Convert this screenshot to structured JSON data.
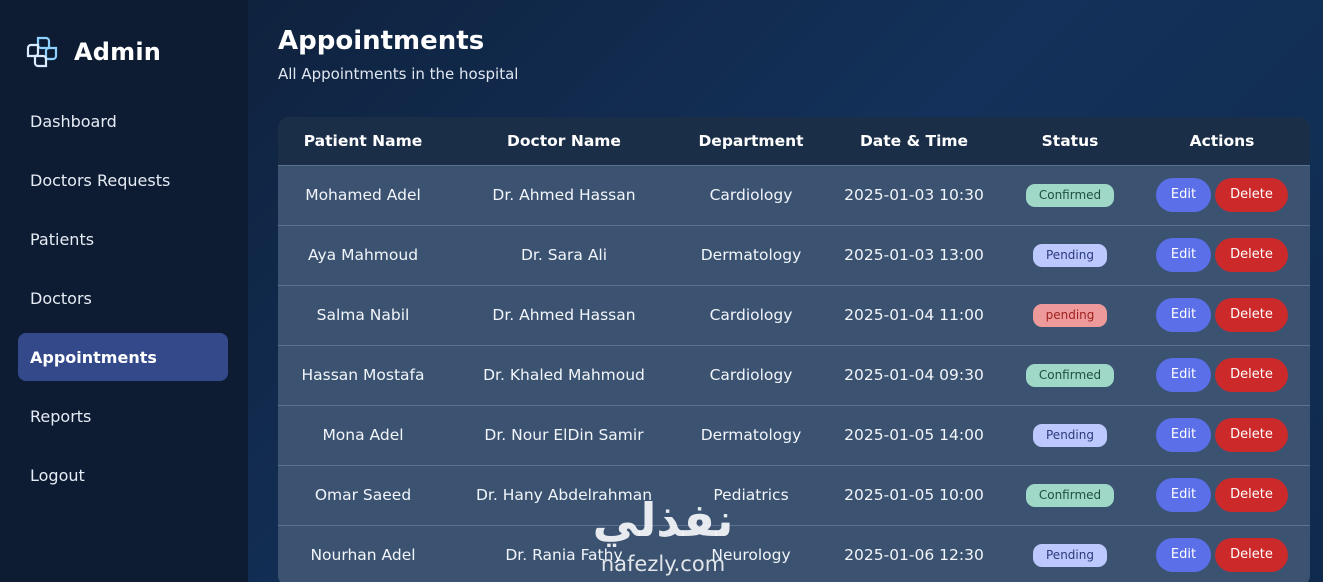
{
  "brand": {
    "name": "Admin",
    "icon": "medical-cross-icon"
  },
  "sidebar": {
    "items": [
      {
        "label": "Dashboard",
        "active": false
      },
      {
        "label": "Doctors Requests",
        "active": false
      },
      {
        "label": "Patients",
        "active": false
      },
      {
        "label": "Doctors",
        "active": false
      },
      {
        "label": "Appointments",
        "active": true
      },
      {
        "label": "Reports",
        "active": false
      },
      {
        "label": "Logout",
        "active": false
      }
    ]
  },
  "page": {
    "title": "Appointments",
    "subtitle": "All Appointments in the hospital"
  },
  "table": {
    "columns": [
      "Patient Name",
      "Doctor Name",
      "Department",
      "Date & Time",
      "Status",
      "Actions"
    ],
    "edit_label": "Edit",
    "delete_label": "Delete",
    "rows": [
      {
        "patient": "Mohamed Adel",
        "doctor": "Dr. Ahmed Hassan",
        "department": "Cardiology",
        "datetime": "2025-01-03 10:30",
        "status": "Confirmed",
        "status_style": "confirmed"
      },
      {
        "patient": "Aya Mahmoud",
        "doctor": "Dr. Sara Ali",
        "department": "Dermatology",
        "datetime": "2025-01-03 13:00",
        "status": "Pending",
        "status_style": "pending"
      },
      {
        "patient": "Salma Nabil",
        "doctor": "Dr. Ahmed Hassan",
        "department": "Cardiology",
        "datetime": "2025-01-04 11:00",
        "status": "pending",
        "status_style": "pending-red"
      },
      {
        "patient": "Hassan Mostafa",
        "doctor": "Dr. Khaled Mahmoud",
        "department": "Cardiology",
        "datetime": "2025-01-04 09:30",
        "status": "Confirmed",
        "status_style": "confirmed"
      },
      {
        "patient": "Mona Adel",
        "doctor": "Dr. Nour ElDin Samir",
        "department": "Dermatology",
        "datetime": "2025-01-05 14:00",
        "status": "Pending",
        "status_style": "pending"
      },
      {
        "patient": "Omar Saeed",
        "doctor": "Dr. Hany Abdelrahman",
        "department": "Pediatrics",
        "datetime": "2025-01-05 10:00",
        "status": "Confirmed",
        "status_style": "confirmed"
      },
      {
        "patient": "Nourhan Adel",
        "doctor": "Dr. Rania Fathy",
        "department": "Neurology",
        "datetime": "2025-01-06 12:30",
        "status": "Pending",
        "status_style": "pending"
      }
    ]
  },
  "watermark": {
    "arabic": "نفذلي",
    "latin": "nafezly.com"
  },
  "colors": {
    "sidebar_bg": "#0e1c33",
    "active_nav": "#33498a",
    "edit_button": "#5a6fe8",
    "delete_button": "#cc2a2a",
    "confirmed_badge": "#9fd8c6",
    "pending_badge": "#bdc8ff",
    "pending_red_badge": "#ef9a9a"
  }
}
